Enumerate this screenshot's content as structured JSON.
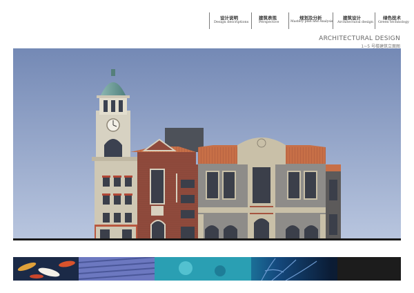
{
  "nav": [
    {
      "zh": "设计说明",
      "en": "Design descriptions"
    },
    {
      "zh": "建筑表现",
      "en": "Perspective"
    },
    {
      "zh": "规划及分析",
      "en": "Mastery plan and Analysis"
    },
    {
      "zh": "建筑设计",
      "en": "Architectural design"
    },
    {
      "zh": "绿色技术",
      "en": "Green technology"
    }
  ],
  "heading": {
    "title": "ARCHITECTURAL DESIGN",
    "subtitle": "1~5 号楼建筑立面图"
  },
  "colors": {
    "sky_top": "#7d93bd",
    "sky_bottom": "#b4c3de",
    "brick": "#8e4a3d",
    "roof": "#c26d45",
    "stone": "#c9c0a8",
    "gray_facade": "#8f8d8a",
    "dome": "#6f9c99"
  }
}
